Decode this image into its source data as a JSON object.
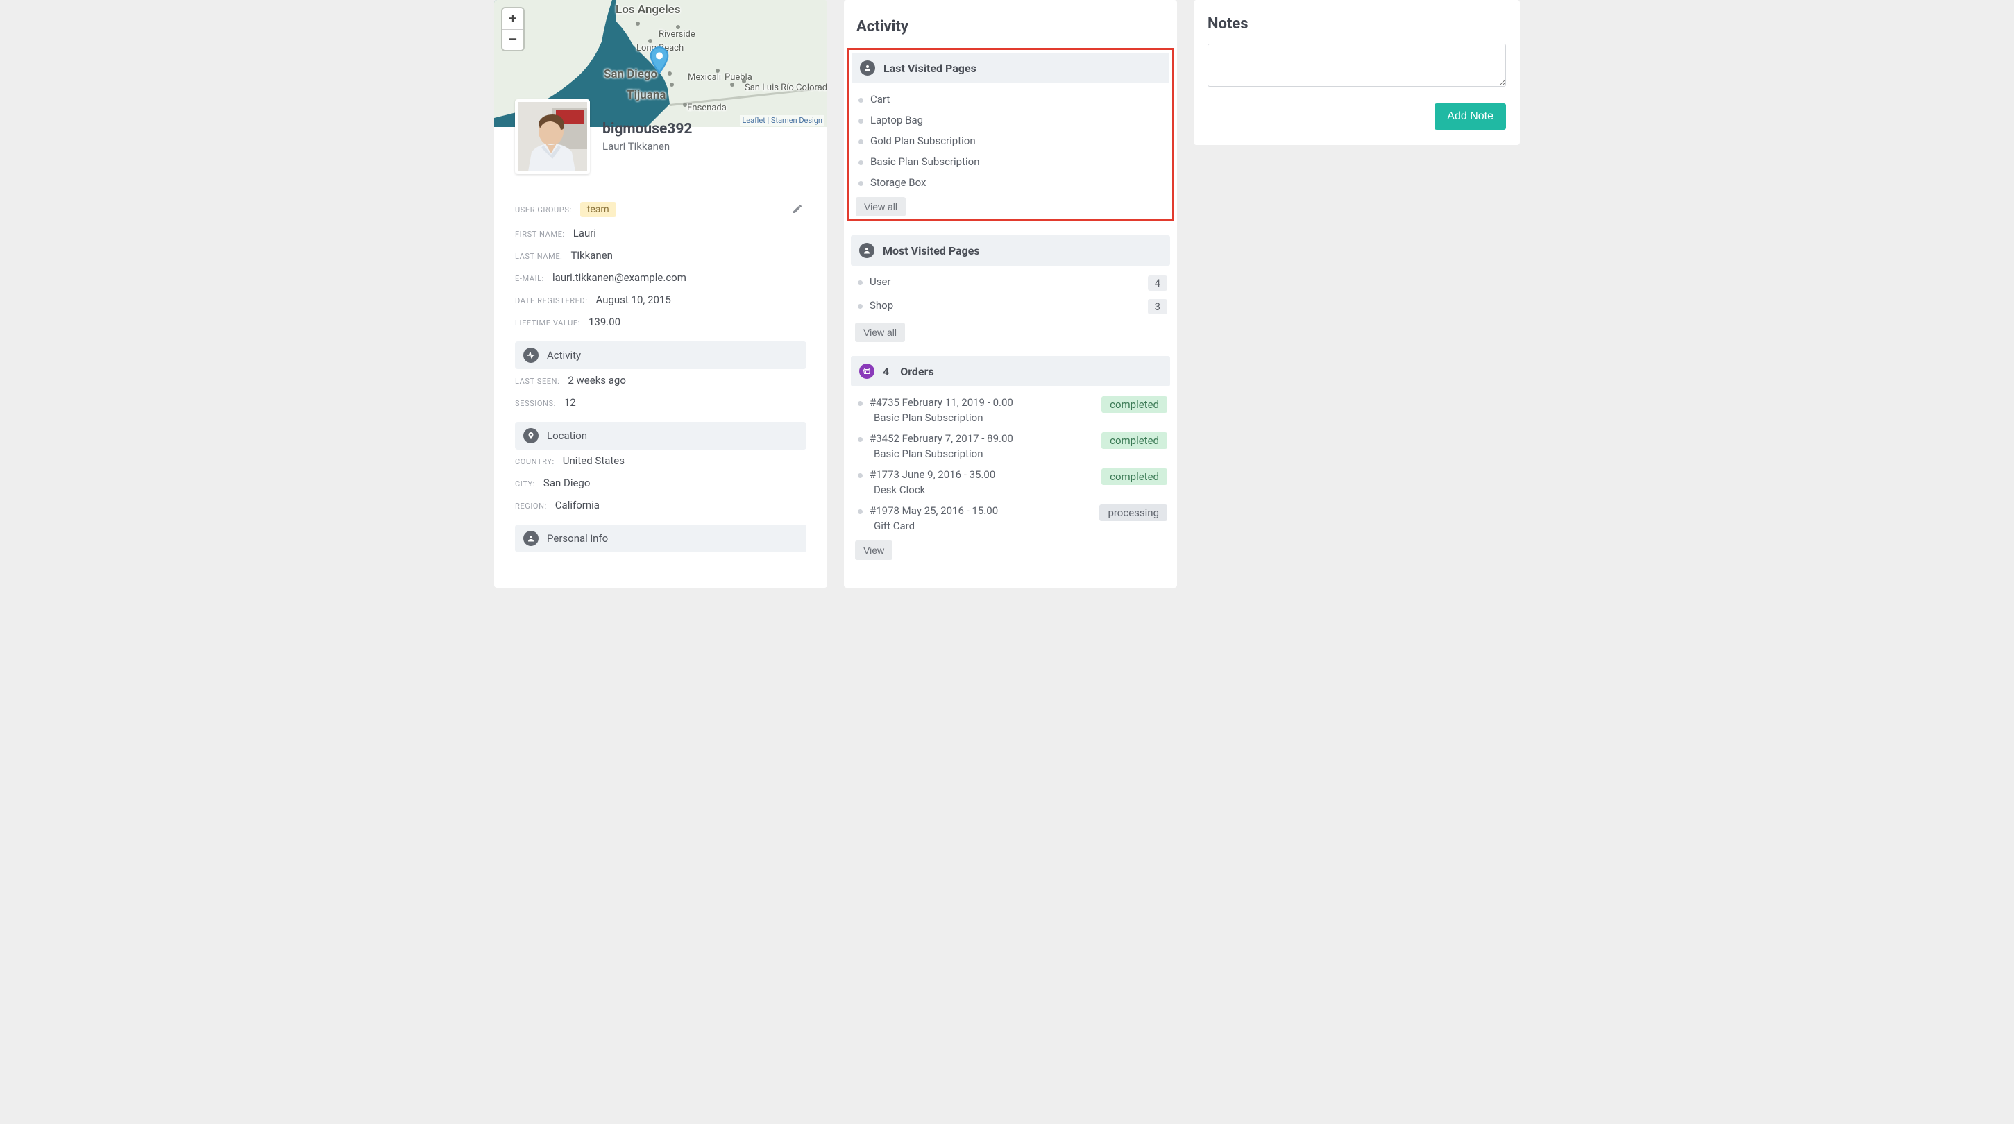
{
  "map": {
    "attribution": "Leaflet | Stamen Design",
    "zoom_in": "+",
    "zoom_out": "−",
    "cities": {
      "los_angeles": "Los Angeles",
      "riverside": "Riverside",
      "long_beach": "Long Beach",
      "san_diego": "San Diego",
      "mexicali": "Mexicali",
      "puebla": "Puebla",
      "san_luis": "San Luis Río Colorado",
      "tijuana": "Tijuana",
      "ensenada": "Ensenada"
    }
  },
  "profile": {
    "username": "bigmouse392",
    "fullname": "Lauri Tikkanen",
    "labels": {
      "user_groups": "USER GROUPS:",
      "first_name": "FIRST NAME:",
      "last_name": "LAST NAME:",
      "email": "E-MAIL:",
      "date_registered": "DATE REGISTERED:",
      "lifetime_value": "LIFETIME VALUE:"
    },
    "user_group_tag": "team",
    "first_name": "Lauri",
    "last_name": "Tikkanen",
    "email": "lauri.tikkanen@example.com",
    "date_registered": "August 10, 2015",
    "lifetime_value": "139.00"
  },
  "activity_section": {
    "title": "Activity",
    "labels": {
      "last_seen": "LAST SEEN:",
      "sessions": "SESSIONS:"
    },
    "last_seen": "2 weeks ago",
    "sessions": "12"
  },
  "location_section": {
    "title": "Location",
    "labels": {
      "country": "COUNTRY:",
      "city": "CITY:",
      "region": "REGION:"
    },
    "country": "United States",
    "city": "San Diego",
    "region": "California"
  },
  "personal_info_section": {
    "title": "Personal info"
  },
  "mid": {
    "heading": "Activity",
    "last_visited": {
      "title": "Last Visited Pages",
      "items": [
        "Cart",
        "Laptop Bag",
        "Gold Plan Subscription",
        "Basic Plan Subscription",
        "Storage Box"
      ],
      "view_all": "View all"
    },
    "most_visited": {
      "title": "Most Visited Pages",
      "items": [
        {
          "name": "User",
          "count": "4"
        },
        {
          "name": "Shop",
          "count": "3"
        }
      ],
      "view_all": "View all"
    },
    "orders": {
      "count": "4",
      "title": "Orders",
      "items": [
        {
          "line": "#4735 February 11, 2019 - 0.00",
          "sub": "Basic Plan Subscription",
          "status": "completed"
        },
        {
          "line": "#3452 February 7, 2017 - 89.00",
          "sub": "Basic Plan Subscription",
          "status": "completed"
        },
        {
          "line": "#1773 June 9, 2016 - 35.00",
          "sub": "Desk Clock",
          "status": "completed"
        },
        {
          "line": "#1978 May 25, 2016 - 15.00",
          "sub": "Gift Card",
          "status": "processing"
        }
      ],
      "view": "View"
    }
  },
  "notes": {
    "heading": "Notes",
    "button": "Add Note",
    "placeholder": ""
  }
}
